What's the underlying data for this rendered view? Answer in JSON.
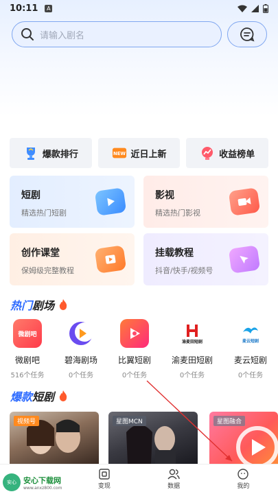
{
  "status": {
    "time": "10:11",
    "a_badge": "A"
  },
  "search": {
    "placeholder": "请输入剧名"
  },
  "quick_actions": [
    {
      "label": "爆款排行",
      "icon": "trophy-icon"
    },
    {
      "label": "近日上新",
      "icon": "new-badge-icon",
      "badge": "NEW"
    },
    {
      "label": "收益榜单",
      "icon": "chart-up-icon"
    }
  ],
  "cards": [
    {
      "title": "短剧",
      "subtitle": "精选热门短剧",
      "icon": "play-card-icon"
    },
    {
      "title": "影视",
      "subtitle": "精选热门影视",
      "icon": "video-camera-icon"
    },
    {
      "title": "创作课堂",
      "subtitle": "保姆级完整教程",
      "icon": "classroom-icon"
    },
    {
      "title": "挂载教程",
      "subtitle": "抖音/快手/视频号",
      "icon": "cursor-icon"
    }
  ],
  "section_hot": {
    "part1": "热门",
    "part2": "剧场"
  },
  "apps": [
    {
      "name": "微剧吧",
      "tasks": "516个任务",
      "logo_text": "微剧吧",
      "color": "#ff4a5a"
    },
    {
      "name": "碧海剧场",
      "tasks": "0个任务",
      "logo_text": "",
      "color": "#6a4cf0"
    },
    {
      "name": "比翼短剧",
      "tasks": "0个任务",
      "logo_text": "",
      "color": "#ff3b6b"
    },
    {
      "name": "渝麦田短剧",
      "tasks": "0个任务",
      "logo_text": "渝麦田短剧",
      "color": "#e02020"
    },
    {
      "name": "麦云短剧",
      "tasks": "0个任务",
      "logo_text": "麦云短剧",
      "color": "#1aa3e8"
    }
  ],
  "section_hit": {
    "part1": "爆款",
    "part2": "短剧"
  },
  "posters": [
    {
      "tag": "视频号"
    },
    {
      "tag": "星图MCN"
    },
    {
      "tag": "星图融合"
    }
  ],
  "nav": [
    {
      "label": "",
      "icon": "home-icon"
    },
    {
      "label": "变现",
      "icon": "monetize-icon"
    },
    {
      "label": "数据",
      "icon": "users-icon"
    },
    {
      "label": "我的",
      "icon": "profile-icon"
    }
  ],
  "watermark": {
    "logo": "安心",
    "name": "安心下载网",
    "url": "www.anxz800.com"
  },
  "colors": {
    "accent": "#2d6bff",
    "flame": "#ff5a2c"
  }
}
